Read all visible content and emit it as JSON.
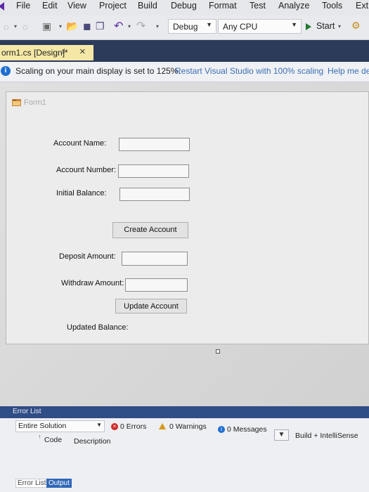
{
  "menu": [
    "File",
    "Edit",
    "View",
    "Project",
    "Build",
    "Debug",
    "Format",
    "Test",
    "Analyze",
    "Tools",
    "Ext"
  ],
  "toolbar": {
    "config": "Debug",
    "platform": "Any CPU",
    "start_label": "Start"
  },
  "document_tab": {
    "label": "orm1.cs [Design]*"
  },
  "infobar": {
    "message": "Scaling on your main display is set to 125%.",
    "restart_link": "Restart Visual Studio with 100% scaling",
    "help_link": "Help me de"
  },
  "form": {
    "title": "Form1",
    "account_name_label": "Account Name:",
    "account_number_label": "Account Number:",
    "initial_balance_label": "Initial Balance:",
    "create_button": "Create Account",
    "deposit_label": "Deposit Amount:",
    "withdraw_label": "Withdraw Amount:",
    "update_button": "Update Account",
    "updated_balance_label": "Updated Balance:"
  },
  "error_list": {
    "title": "Error List",
    "scope": "Entire Solution",
    "errors": "0 Errors",
    "warnings": "0 Warnings",
    "messages": "0 Messages",
    "build_filter": "Build + IntelliSense",
    "col_code": "Code",
    "col_description": "Description"
  },
  "bottom_tabs": {
    "error_list": "Error List",
    "output": "Output"
  },
  "colors": {
    "accent_blue": "#2f67b8",
    "tab_yellow": "#f5e8a6",
    "dark_band": "#2d3b5a"
  }
}
